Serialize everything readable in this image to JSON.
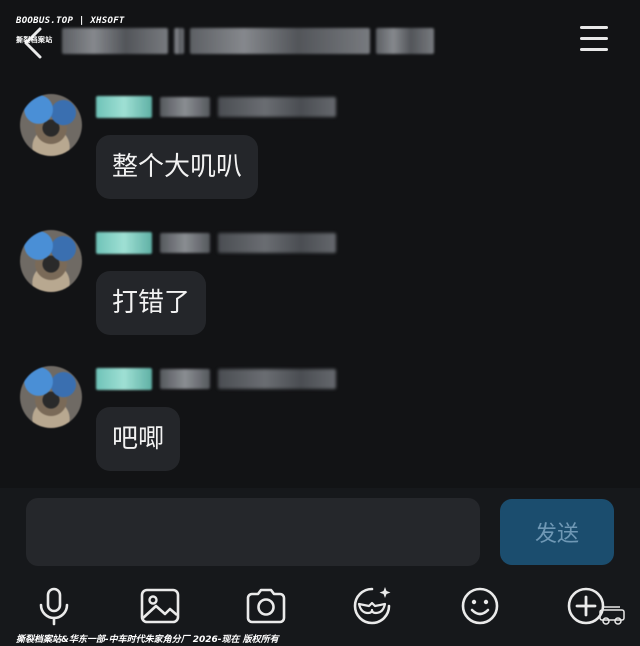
{
  "watermark": {
    "top_line": "BOOBUS.TOP | XHSOFT",
    "top_sub": "撕裂档案站",
    "bottom": "撕裂档案站&华东一部-中车时代朱家角分厂 2026-现在 版权所有"
  },
  "header": {
    "back_icon": "chevron-left-icon",
    "menu_icon": "hamburger-menu-icon"
  },
  "messages": [
    {
      "text": "整个大叽叭"
    },
    {
      "text": "打错了"
    },
    {
      "text": "吧唧"
    }
  ],
  "composer": {
    "placeholder": "",
    "value": "",
    "send_label": "发送"
  },
  "toolbar": {
    "icons": [
      "microphone-icon",
      "image-icon",
      "camera-icon",
      "sticker-icon",
      "emoji-icon",
      "plus-icon"
    ]
  },
  "colors": {
    "background": "#121315",
    "bubble": "#24262a",
    "send_button": "#1b4d6e",
    "send_text": "#6f98b5"
  }
}
